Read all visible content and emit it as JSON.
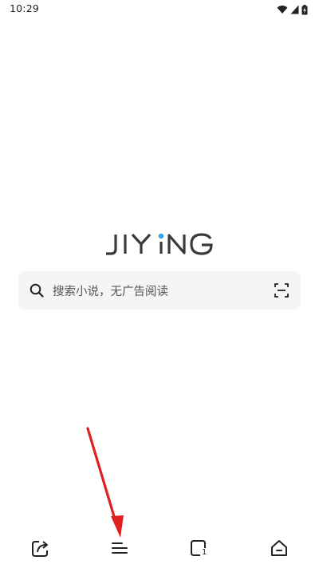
{
  "status_bar": {
    "time": "10:29",
    "icons": [
      "wifi-icon",
      "cellular-signal-icon",
      "battery-charging-icon"
    ]
  },
  "logo": {
    "text": "JIYiNG",
    "dot_color": "#2aa6e0"
  },
  "search": {
    "placeholder": "搜索小说，无广告阅读",
    "left_icon": "search-icon",
    "right_icon": "scan-icon"
  },
  "bottom_nav": {
    "items": [
      {
        "icon": "share-export-icon"
      },
      {
        "icon": "menu-icon"
      },
      {
        "icon": "tabs-icon",
        "badge": "1"
      },
      {
        "icon": "home-icon"
      }
    ]
  },
  "colors": {
    "background": "#ffffff",
    "search_bg": "#f5f5f5",
    "text_primary": "#222222",
    "annotation_arrow": "#e02020"
  }
}
